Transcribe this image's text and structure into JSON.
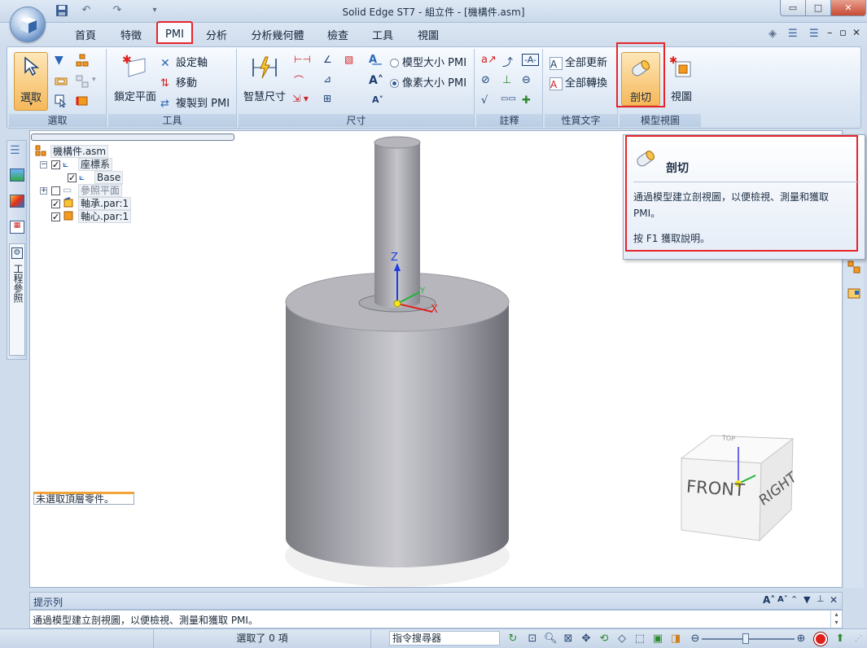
{
  "window": {
    "title": "Solid Edge ST7 - 組立件 - [機構件.asm]",
    "minimize": "▭",
    "maximize": "□",
    "close": "✕"
  },
  "qat": {
    "save": "save-icon",
    "undo": "↶",
    "redo": "↷",
    "dropdown": "▾"
  },
  "tabs": [
    "首頁",
    "特徵",
    "PMI",
    "分析",
    "分析幾何體",
    "檢查",
    "工具",
    "視圖"
  ],
  "active_tab": "PMI",
  "tab_right_icons": [
    "◈",
    "☰",
    "☰",
    "–",
    "▫",
    "✕"
  ],
  "ribbon": {
    "select": {
      "label": "選取",
      "group": "選取"
    },
    "tools": {
      "lock_plane": "鎖定平面",
      "set_axis": "設定軸",
      "move": "移動",
      "copy_to_pmi": "複製到 PMI",
      "group": "工具"
    },
    "dimension": {
      "smart_dimension": "智慧尺寸",
      "model_size_pmi": "模型大小 PMI",
      "pixel_size_pmi": "像素大小 PMI",
      "group": "尺寸"
    },
    "annotation": {
      "group": "註釋"
    },
    "property_text": {
      "update_all": "全部更新",
      "convert_all": "全部轉換",
      "group": "性質文字"
    },
    "model_view": {
      "section": "剖切",
      "view": "視圖",
      "group": "模型視圖"
    }
  },
  "tree": {
    "root": "機構件.asm",
    "coordinate_systems": "座標系",
    "base": "Base",
    "reference_planes": "參照平面",
    "bearing": "軸承.par:1",
    "shaft": "軸心.par:1"
  },
  "left_strip": {
    "label": "工程參照"
  },
  "canvas": {
    "no_top_part": "未選取頂層零件。",
    "axis_z": "Z",
    "axis_x": "X",
    "axis_y": "Y",
    "cube_front": "FRONT",
    "cube_right": "RIGHT",
    "cube_top": "TOP"
  },
  "tooltip": {
    "title": "剖切",
    "body": "通過模型建立剖視圖，以便檢視、測量和獲取 PMI。",
    "help": "按 F1 獲取說明。"
  },
  "prompt": {
    "header": "提示列",
    "text": "通過模型建立剖視圖，以便檢視、測量和獲取 PMI。"
  },
  "status": {
    "selected": "選取了 0 項",
    "command_finder": "指令搜尋器"
  },
  "colors": {
    "accent_red": "#e8242a",
    "ribbon_bg": "#dce7f4",
    "select_button": "#f8c77a",
    "axis_x": "#e0201c",
    "axis_y": "#21b43a",
    "axis_z": "#1c3ee0"
  }
}
